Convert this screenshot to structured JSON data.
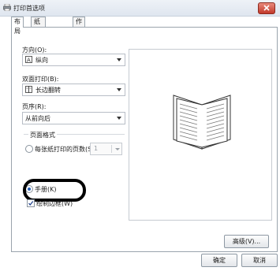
{
  "window": {
    "title": "打印首选项"
  },
  "tabs": [
    {
      "label": "布局",
      "active": true
    },
    {
      "label": "纸张/质量",
      "active": false
    },
    {
      "label": "作业选项",
      "active": false
    }
  ],
  "orientation": {
    "label": "方向(O):",
    "value": "纵向",
    "icon": "portrait-page-icon"
  },
  "duplex": {
    "label": "双面打印(B):",
    "value": "长边翻转",
    "icon": "duplex-long-edge-icon"
  },
  "page_order": {
    "label": "页序(R):",
    "value": "从前向后"
  },
  "page_format": {
    "title": "页面格式",
    "pages_per_sheet": {
      "label": "每张纸打印的页数(S",
      "value": "1",
      "selected": false
    },
    "booklet": {
      "label": "手册(K)",
      "selected": true
    },
    "draw_borders": {
      "label": "绘制边框(W)",
      "checked": true
    }
  },
  "preview": {
    "icon": "open-booklet-icon"
  },
  "buttons": {
    "advanced": "高级(V)...",
    "ok": "确定",
    "cancel": "取消"
  },
  "colors": {
    "accent": "#2b62b8",
    "close": "#c2392a"
  }
}
